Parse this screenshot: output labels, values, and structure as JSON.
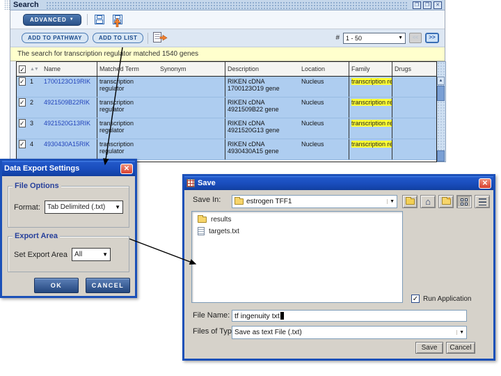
{
  "colors": {
    "titlebar_metal_blue": "#c5d7eb",
    "xp_title_blue": "#1b4fc0",
    "selection_blue": "#aecdf0",
    "highlight_yellow": "#ffff33",
    "info_bar_yellow": "#ffffcd",
    "navy_button": "#24477e",
    "link_blue": "#2244bb",
    "orange_accent": "#f08030"
  },
  "icons": {
    "window_controls": [
      "undock-icon",
      "restore-icon",
      "close-icon"
    ],
    "search_toolbar": [
      "save-icon",
      "save-as-icon",
      "cursor-arrow-icon",
      "export-icon"
    ],
    "save_dialog_toolbar": [
      "up-one-level-icon",
      "home-icon",
      "new-folder-icon",
      "list-view-icon",
      "details-view-icon"
    ],
    "file_items": [
      "folder-icon",
      "text-file-icon"
    ]
  },
  "search_window": {
    "title": "Search",
    "toolbar": {
      "advanced_label": "ADVANCED",
      "advanced_caret": "▼",
      "add_to_pathway_label": "ADD TO PATHWAY",
      "add_to_list_label": "ADD TO LIST",
      "range_label": "#",
      "range_value": "1 - 50",
      "prev_label": "<<",
      "next_label": ">>"
    },
    "info_text": "The search for transcription regulator matched 1540 genes",
    "table": {
      "columns": [
        "Name",
        "Matched Term",
        "Synonym",
        "Description",
        "Location",
        "Family",
        "Drugs"
      ],
      "rows": [
        {
          "num": "1",
          "name": "1700123O19RIK",
          "matched_term": "transcription regulator",
          "synonym": "",
          "description": "RIKEN cDNA 1700123O19 gene",
          "location": "Nucleus",
          "family": "transcription reg",
          "drugs": ""
        },
        {
          "num": "2",
          "name": "4921509B22RIK",
          "matched_term": "transcription regulator",
          "synonym": "",
          "description": "RIKEN cDNA 4921509B22 gene",
          "location": "Nucleus",
          "family": "transcription reg",
          "drugs": ""
        },
        {
          "num": "3",
          "name": "4921520G13RIK",
          "matched_term": "transcription regulator",
          "synonym": "",
          "description": "RIKEN cDNA 4921520G13 gene",
          "location": "Nucleus",
          "family": "transcription reg",
          "drugs": ""
        },
        {
          "num": "4",
          "name": "4930430A15RIK",
          "matched_term": "transcription regulator",
          "synonym": "",
          "description": "RIKEN cDNA 4930430A15 gene",
          "location": "Nucleus",
          "family": "transcription reg",
          "drugs": ""
        }
      ]
    }
  },
  "export_dialog": {
    "title": "Data Export Settings",
    "file_options_label": "File Options",
    "format_label": "Format:",
    "format_value": "Tab Delimited (.txt)",
    "export_area_label": "Export Area",
    "set_export_area_label": "Set Export Area",
    "export_area_value": "All",
    "ok_label": "OK",
    "cancel_label": "CANCEL"
  },
  "save_dialog": {
    "title": "Save",
    "save_in_label": "Save In:",
    "save_in_value": "estrogen TFF1",
    "files": [
      {
        "name": "results",
        "type": "folder"
      },
      {
        "name": "targets.txt",
        "type": "file"
      }
    ],
    "run_application_label": "Run Application",
    "run_application_checked": "✓",
    "file_name_label": "File Name:",
    "file_name_value": "tf ingenuity txt",
    "files_of_type_label": "Files of Type:",
    "files_of_type_value": "Save as text File (.txt)",
    "save_label": "Save",
    "cancel_label": "Cancel"
  }
}
